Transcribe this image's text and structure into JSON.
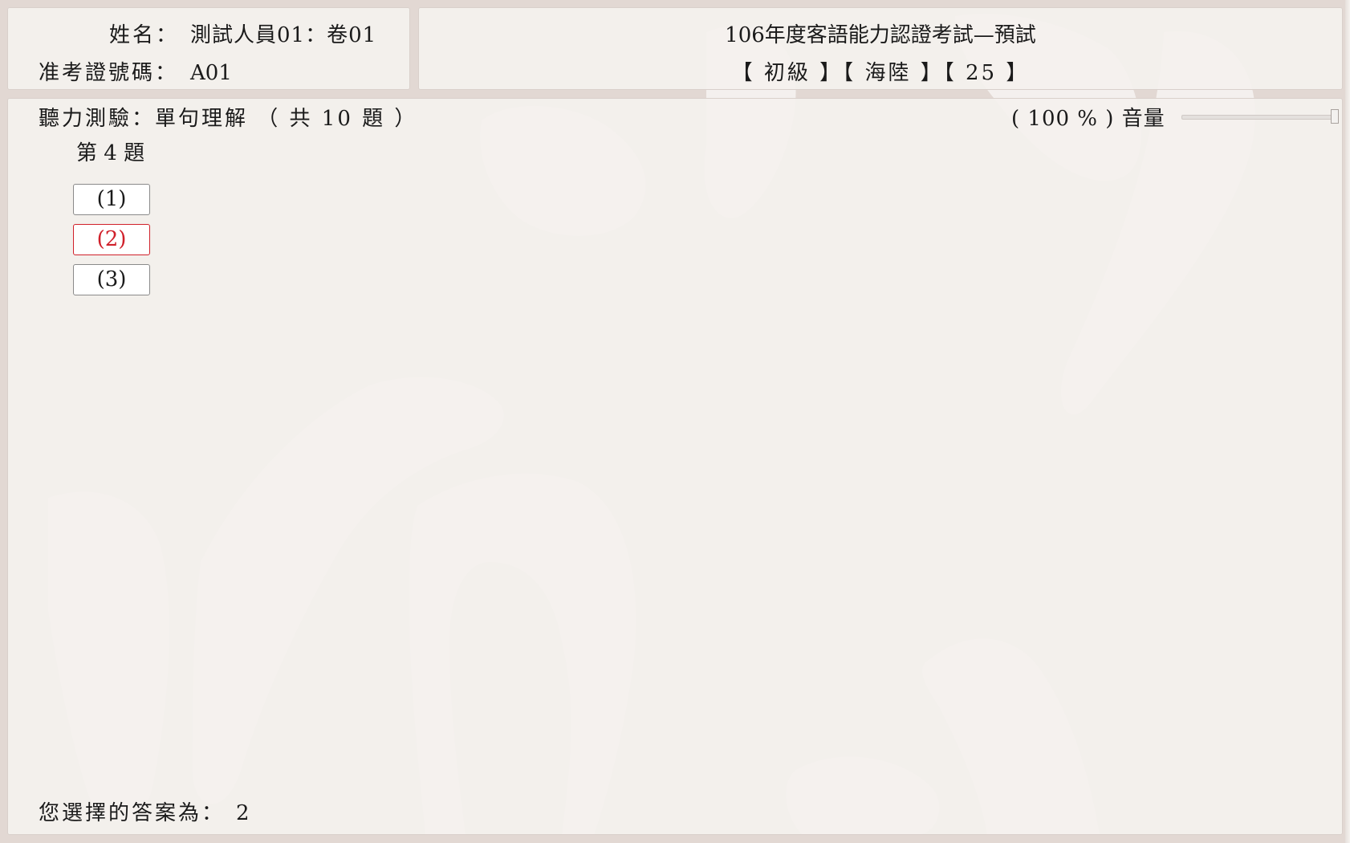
{
  "candidate": {
    "name_label": "姓名：",
    "name_value": "測試人員01：卷01",
    "id_label": "准考證號碼：",
    "id_value": "A01"
  },
  "exam": {
    "title": "106年度客語能力認證考試—預試",
    "tags": "【 初級 】【 海陸 】【 25 】"
  },
  "section": {
    "title": "聽力測驗：單句理解 （ 共 10 題 ）",
    "question": "第 4 題"
  },
  "volume": {
    "display": "(  100 % ) 音量",
    "level_percent": 100
  },
  "options": [
    {
      "label": "(1)",
      "selected": false
    },
    {
      "label": "(2)",
      "selected": true
    },
    {
      "label": "(3)",
      "selected": false
    }
  ],
  "answer": {
    "label": "您選擇的答案為：",
    "value": "2"
  },
  "colors": {
    "selected": "#d0202a",
    "background": "#e2d8d3",
    "panel": "#f4f1ee"
  }
}
